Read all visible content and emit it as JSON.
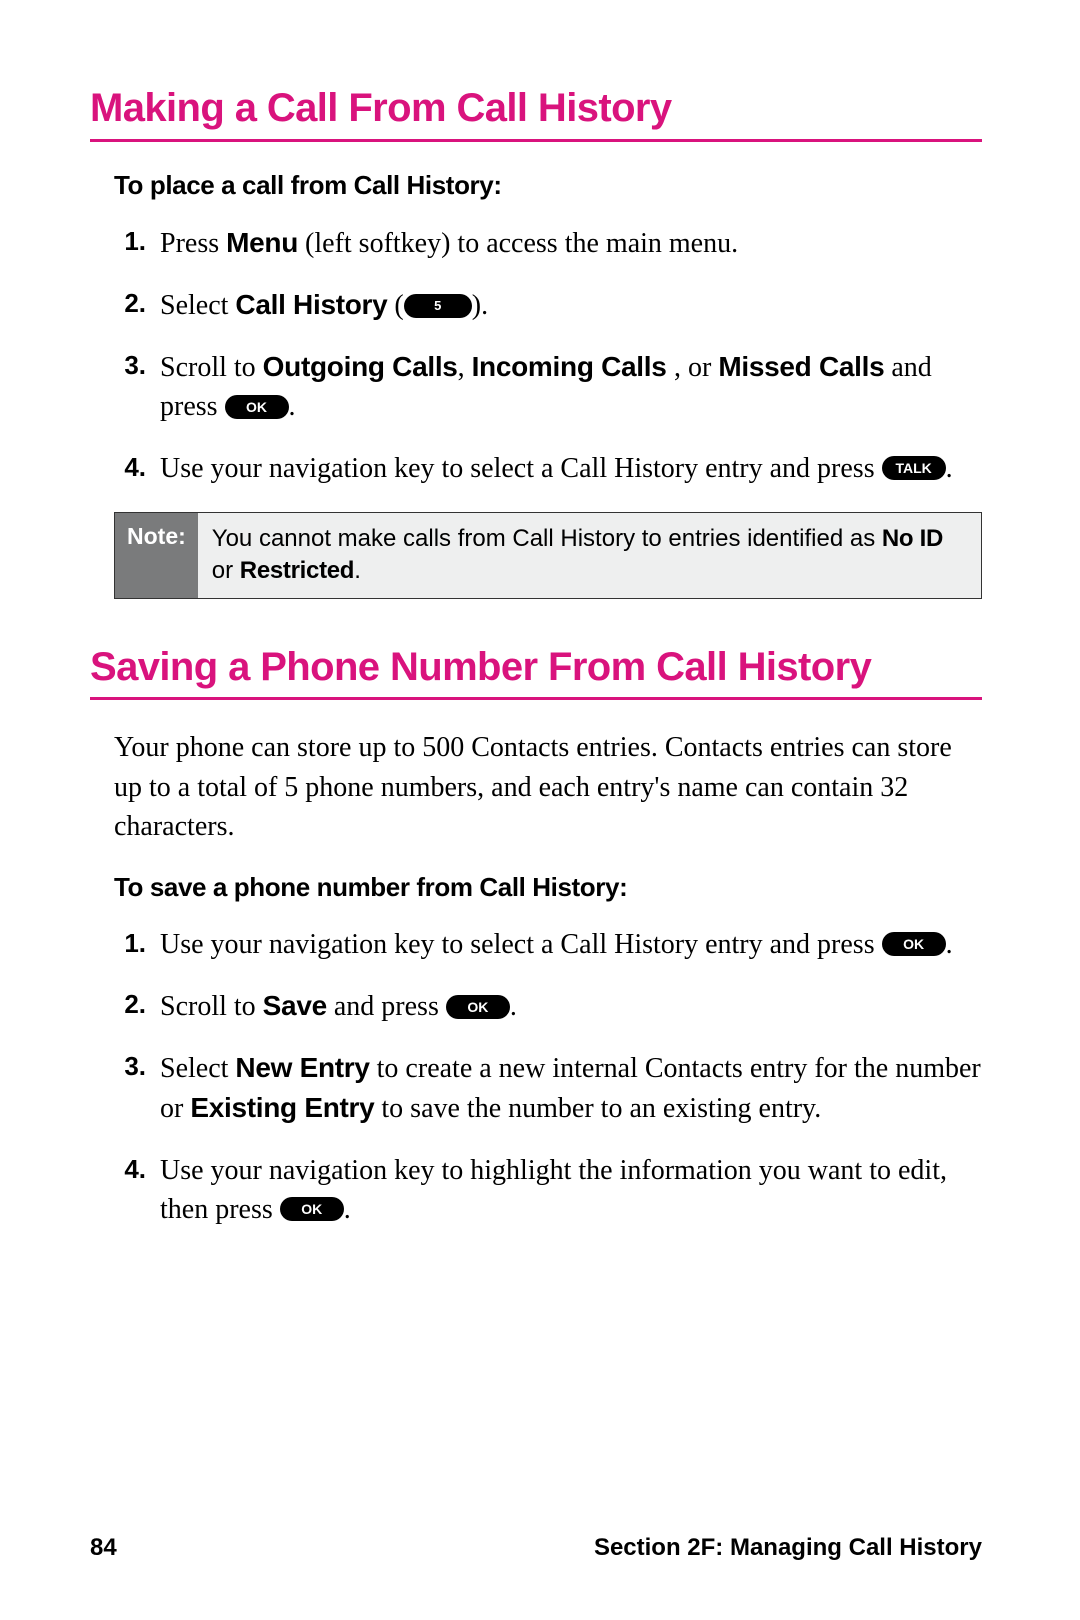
{
  "colors": {
    "accent": "#d9137d"
  },
  "headings": {
    "h1": "Making a Call From Call History",
    "h2": "Saving a Phone Number From Call History"
  },
  "sub1": "To place a call from Call History:",
  "sub2": "To save a phone number from Call History:",
  "steps1": {
    "s1": {
      "num": "1.",
      "a": "Press ",
      "menu": "Menu",
      "b": " (left softkey) to access the main menu."
    },
    "s2": {
      "num": "2.",
      "a": "Select ",
      "ch": "Call History",
      "b": " (",
      "pill": "5",
      "c": ")."
    },
    "s3": {
      "num": "3.",
      "a": "Scroll to ",
      "out": "Outgoing Calls",
      "comma": ", ",
      "inc": "Incoming Calls ",
      "or": ", or ",
      "miss": "Missed Calls",
      "b": " and press ",
      "pill": "OK",
      "c": "."
    },
    "s4": {
      "num": "4.",
      "a": "Use your navigation key to select a Call History entry and press ",
      "pill": "TALK",
      "b": "."
    }
  },
  "note": {
    "label": "Note:",
    "a": "You cannot make calls from Call History to entries identified as ",
    "noid": "No ID",
    "or": " or ",
    "restr": "Restricted",
    "dot": "."
  },
  "para": "Your phone can store up to 500 Contacts entries. Contacts entries can store up to a total of 5 phone numbers, and each entry's name can contain 32 characters.",
  "steps2": {
    "s1": {
      "num": "1.",
      "a": "Use your navigation key to select a Call History entry and press ",
      "pill": "OK",
      "b": "."
    },
    "s2": {
      "num": "2.",
      "a": "Scroll to ",
      "save": "Save",
      "b": " and press ",
      "pill": "OK",
      "c": "."
    },
    "s3": {
      "num": "3.",
      "a": "Select ",
      "new": "New Entry",
      "b": " to create a new internal Contacts entry for the number or ",
      "ex": "Existing Entry",
      "c": " to save the number to an existing entry."
    },
    "s4": {
      "num": "4.",
      "a": "Use your navigation key to highlight the information you want to edit, then press ",
      "pill": "OK",
      "b": "."
    }
  },
  "footer": {
    "page": "84",
    "section": "Section 2F: Managing Call History"
  }
}
